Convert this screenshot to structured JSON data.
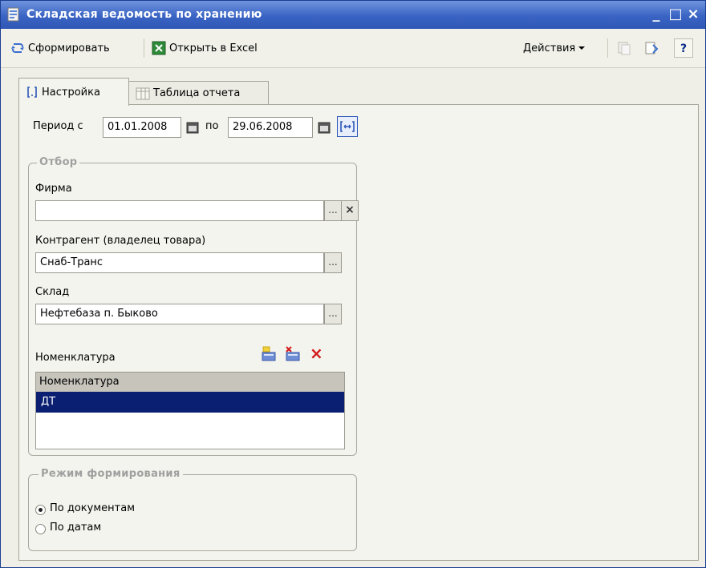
{
  "window": {
    "title": "Складская ведомость по хранению",
    "minimize": "_",
    "maximize": "□",
    "close": "×"
  },
  "toolbar": {
    "generate_label": "Сформировать",
    "excel_label": "Открыть в Excel",
    "actions_label": "Действия",
    "help_label": "?"
  },
  "tabs": [
    {
      "label": "Настройка",
      "active": true
    },
    {
      "label": "Таблица отчета",
      "active": false
    }
  ],
  "period": {
    "from_label": "Период с",
    "from_value": "01.01.2008",
    "to_label": "по",
    "to_value": "29.06.2008"
  },
  "filter": {
    "title": "Отбор",
    "firm_label": "Фирма",
    "firm_value": "",
    "contractor_label": "Контрагент (владелец товара)",
    "contractor_value": "Снаб-Транс",
    "warehouse_label": "Склад",
    "warehouse_value": "Нефтебаза п. Быково",
    "nomenclature_label": "Номенклатура",
    "list_header": "Номенклатура",
    "list_items": [
      "ДТ"
    ]
  },
  "mode": {
    "title": "Режим формирования",
    "options": [
      {
        "label": "По документам",
        "selected": true
      },
      {
        "label": "По датам",
        "selected": false
      }
    ]
  },
  "icons": {
    "select_button": "...",
    "clear_button": "×",
    "delete_icon": "×"
  },
  "colors": {
    "title_bar": "#3a64c4",
    "selected_row": "#0a1e72",
    "delete_red": "#d21a1a"
  }
}
